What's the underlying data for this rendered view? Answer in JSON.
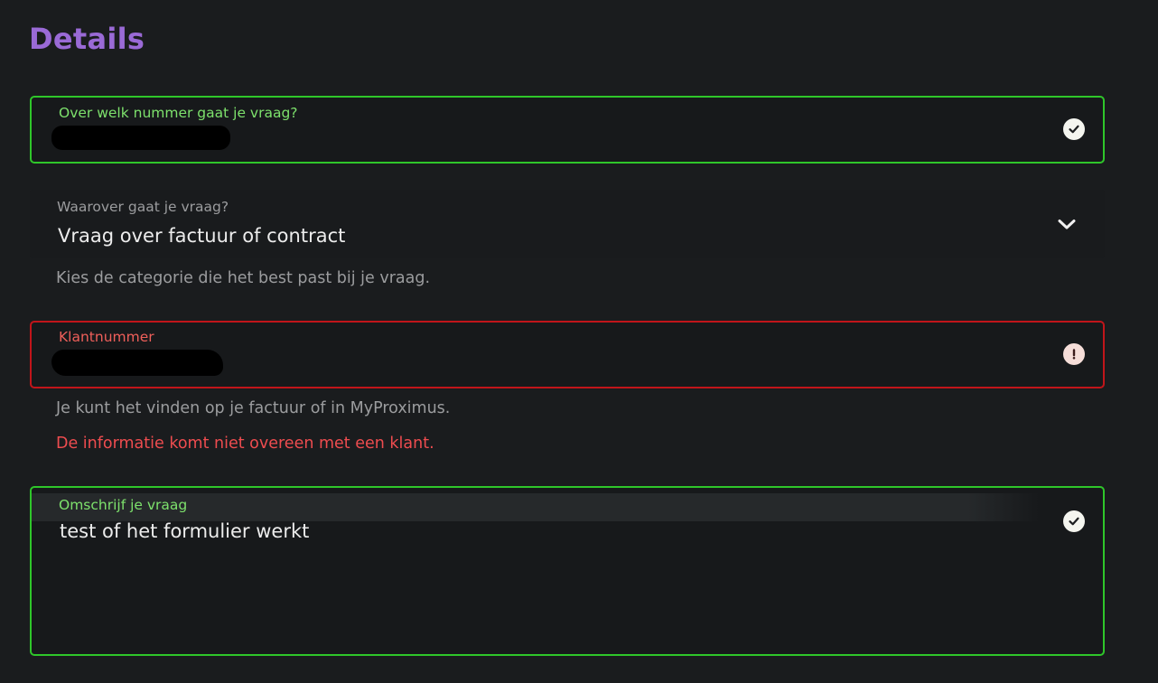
{
  "page": {
    "title": "Details"
  },
  "form": {
    "phone_number": {
      "label": "Over welk nummer gaat je vraag?",
      "status_icon": "check-circle-icon"
    },
    "topic": {
      "label": "Waarover gaat je vraag?",
      "selected": "Vraag over factuur of contract",
      "helper": "Kies de categorie die het best past bij je vraag.",
      "icon": "chevron-down-icon"
    },
    "customer_number": {
      "label": "Klantnummer",
      "helper": "Je kunt het vinden op je factuur of in MyProximus.",
      "error": "De informatie komt niet overeen met een klant.",
      "status_icon": "exclamation-circle-icon"
    },
    "question": {
      "label": "Omschrijf je vraag",
      "value": "test of het formulier werkt",
      "status_icon": "check-circle-icon"
    }
  },
  "colors": {
    "title": "#9a6ad6",
    "valid": "#2fc62a",
    "valid_label": "#7de16c",
    "error": "#c1151a",
    "error_label": "#ef5f5a",
    "error_text": "#ee4c4f",
    "muted": "#9b9c9e",
    "background": "#1a1c1e"
  }
}
